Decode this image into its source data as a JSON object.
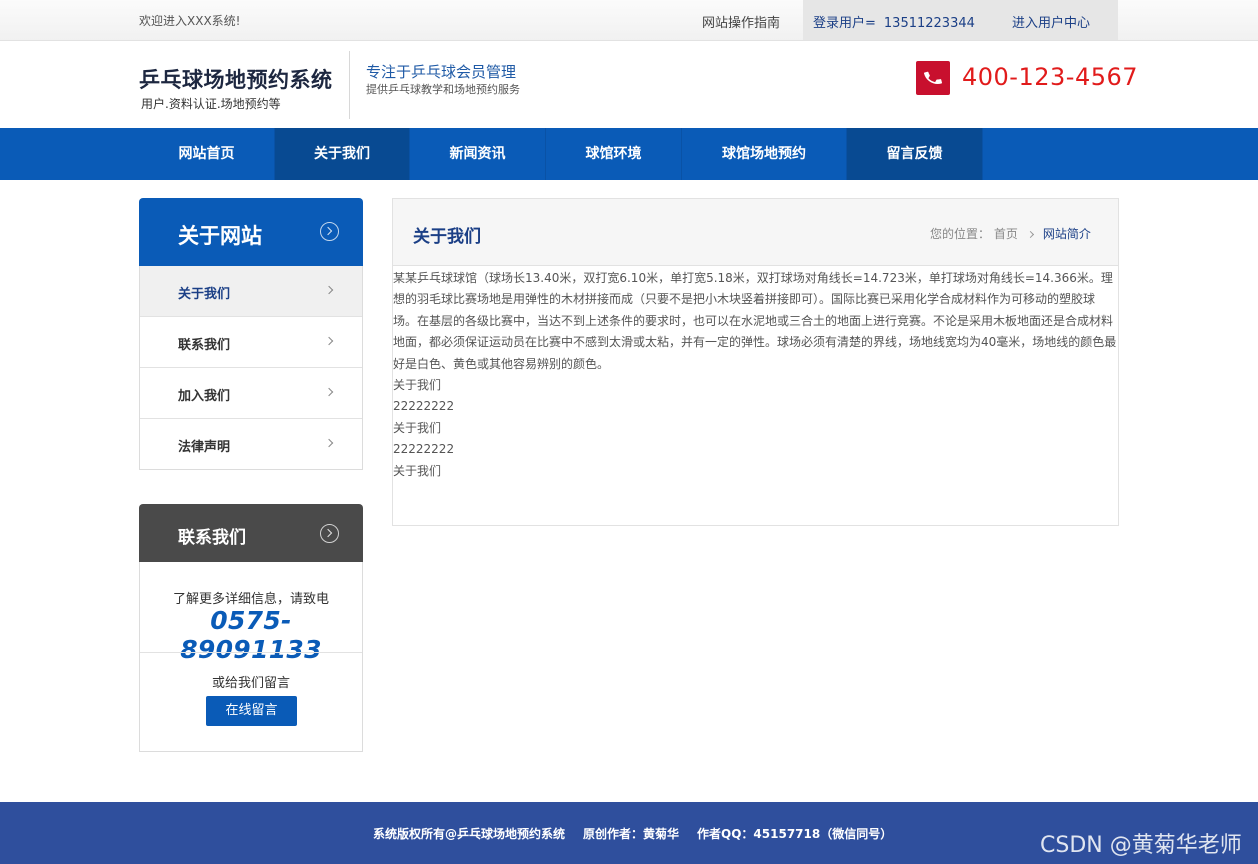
{
  "topbar": {
    "welcome": "欢迎进入XXX系统!",
    "guide": "网站操作指南",
    "login_label": "登录用户=",
    "login_user": "13511223344",
    "user_center": "进入用户中心"
  },
  "header": {
    "title": "乒乓球场地预约系统",
    "subtitle": "用户.资料认证.场地预约等",
    "slogan": "专注于乒乓球会员管理",
    "slogan_sub": "提供乒乓球教学和场地预约服务",
    "hotline": "400-123-4567",
    "accent_color": "#c8102e"
  },
  "nav": {
    "items": [
      {
        "label": "网站首页"
      },
      {
        "label": "关于我们"
      },
      {
        "label": "新闻资讯"
      },
      {
        "label": "球馆环境"
      },
      {
        "label": "球馆场地预约"
      },
      {
        "label": "留言反馈"
      }
    ],
    "active": "关于我们",
    "color": "#0a5bb7"
  },
  "sidebar": {
    "title": "关于网站",
    "items": [
      {
        "label": "关于我们"
      },
      {
        "label": "联系我们"
      },
      {
        "label": "加入我们"
      },
      {
        "label": "法律声明"
      }
    ],
    "active": "关于我们"
  },
  "contact": {
    "title": "联系我们",
    "info": "了解更多详细信息，请致电",
    "phone": "0575-89091133",
    "message_prompt": "或给我们留言",
    "button": "在线留言"
  },
  "main": {
    "title": "关于我们",
    "breadcrumb": {
      "prefix": "您的位置：",
      "home": "首页",
      "current": "网站简介"
    },
    "paragraph": "某某乒乓球球馆（球场长13.40米，双打宽6.10米，单打宽5.18米，双打球场对角线长=14.723米，单打球场对角线长=14.366米。理想的羽毛球比赛场地是用弹性的木材拼接而成（只要不是把小木块竖着拼接即可）。国际比赛已采用化学合成材料作为可移动的塑胶球场。在基层的各级比赛中，当达不到上述条件的要求时，也可以在水泥地或三合土的地面上进行竞赛。不论是采用木板地面还是合成材料地面，都必须保证运动员在比赛中不感到太滑或太粘，并有一定的弹性。球场必须有清楚的界线，场地线宽均为40毫米，场地线的颜色最好是白色、黄色或其他容易辨别的颜色。",
    "lines": [
      "关于我们",
      "22222222",
      "关于我们",
      "22222222",
      "关于我们"
    ]
  },
  "footer": {
    "copyright": "系统版权所有@乒乓球场地预约系统",
    "author": "原创作者：黄菊华",
    "qq": "作者QQ：45157718（微信同号）",
    "color": "#2f4f9d"
  },
  "watermark": "CSDN @黄菊华老师"
}
